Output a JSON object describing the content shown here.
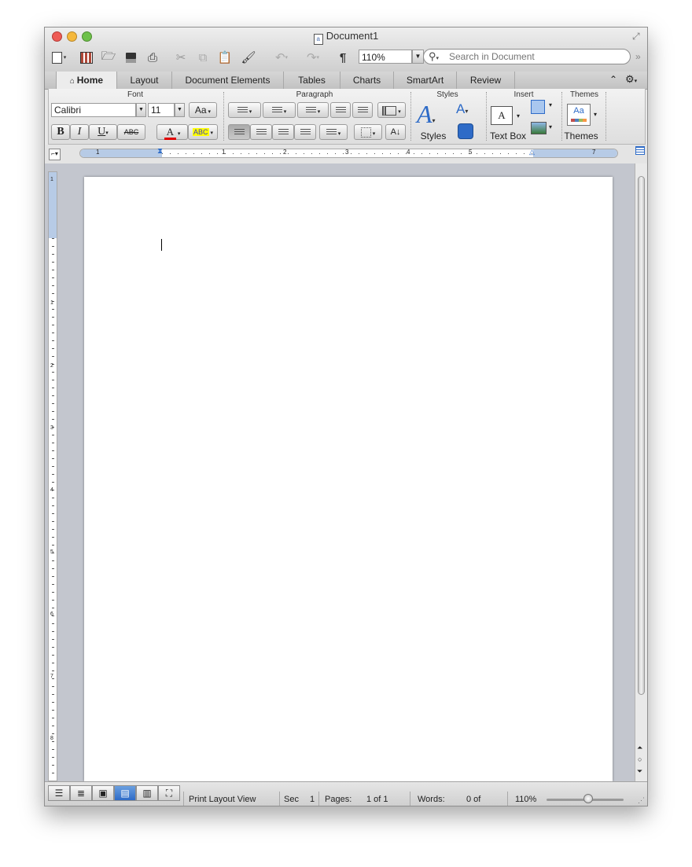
{
  "window": {
    "title": "Document1"
  },
  "toolbar": {
    "zoom": "110%",
    "search_placeholder": "Search in Document",
    "pilcrow": "¶"
  },
  "tabs": [
    "Home",
    "Layout",
    "Document Elements",
    "Tables",
    "Charts",
    "SmartArt",
    "Review"
  ],
  "ribbon": {
    "font_group": "Font",
    "paragraph_group": "Paragraph",
    "styles_group": "Styles",
    "insert_group": "Insert",
    "themes_group": "Themes",
    "font_name": "Calibri",
    "font_size": "11",
    "styles_label": "Styles",
    "textbox_label": "Text Box",
    "themes_label": "Themes",
    "bold": "B",
    "italic": "I",
    "underline": "U",
    "strike": "ABC",
    "font_color": "A",
    "highlight": "ABC",
    "change_case": "Aa",
    "themes_preview": "Aa"
  },
  "ruler": {
    "h_marks": [
      "1",
      "1",
      "2",
      "3",
      "4",
      "5",
      "7"
    ],
    "v_marks": [
      "1",
      "1",
      "2",
      "3",
      "4",
      "5",
      "6",
      "7",
      "8"
    ]
  },
  "status": {
    "view": "Print Layout View",
    "sec_label": "Sec",
    "sec_value": "1",
    "pages_label": "Pages:",
    "pages_value": "1 of 1",
    "words_label": "Words:",
    "words_value": "0 of",
    "zoom": "110%"
  },
  "colors": {
    "accent": "#2e6bc7",
    "font_color": "#e00000",
    "highlight": "#ffff00"
  }
}
